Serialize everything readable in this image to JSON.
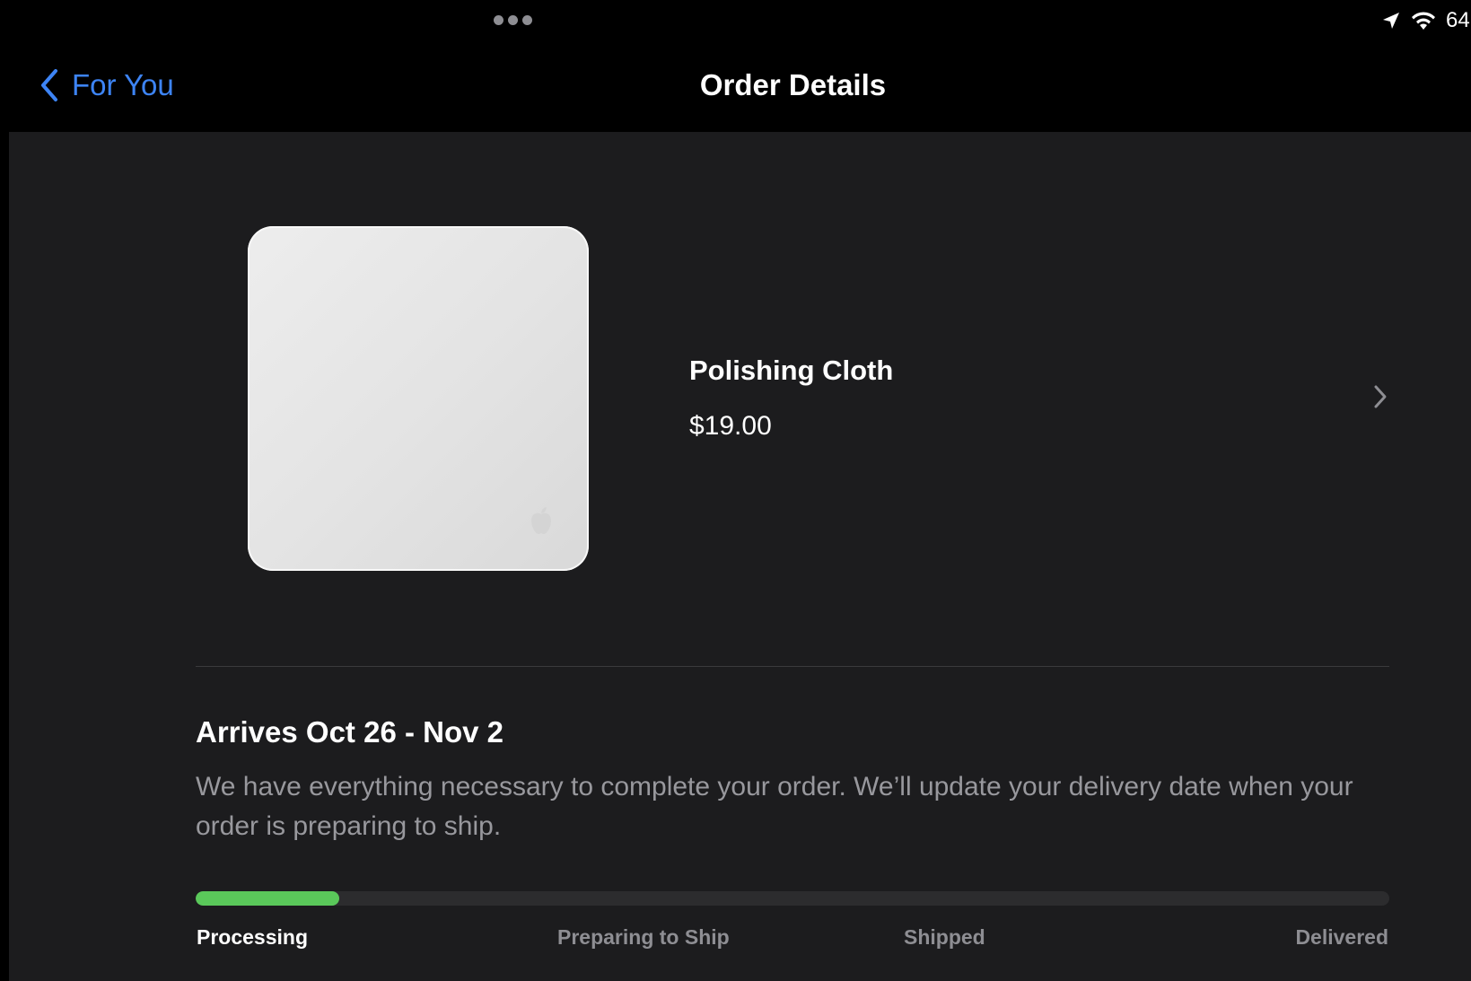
{
  "status_bar": {
    "battery_text": "64",
    "icons": [
      "location-arrow-icon",
      "wifi-icon"
    ]
  },
  "nav": {
    "back_label": "For You",
    "back_icon": "chevron-left-icon",
    "title": "Order Details"
  },
  "product": {
    "name": "Polishing Cloth",
    "price": "$19.00",
    "image_icon": "polishing-cloth-image",
    "detail_icon": "chevron-right-icon"
  },
  "delivery": {
    "title": "Arrives Oct 26 - Nov 2",
    "description": "We have everything necessary to complete your order. We’ll update your delivery date when your order is preparing to ship.",
    "progress_fraction": 0.12,
    "stages": [
      "Processing",
      "Preparing to Ship",
      "Shipped",
      "Delivered"
    ],
    "active_stage": "Processing"
  },
  "colors": {
    "accent_blue": "#3d84f5",
    "progress_green": "#5ac85a",
    "background": "#1c1c1e",
    "nav_background": "#000000"
  }
}
